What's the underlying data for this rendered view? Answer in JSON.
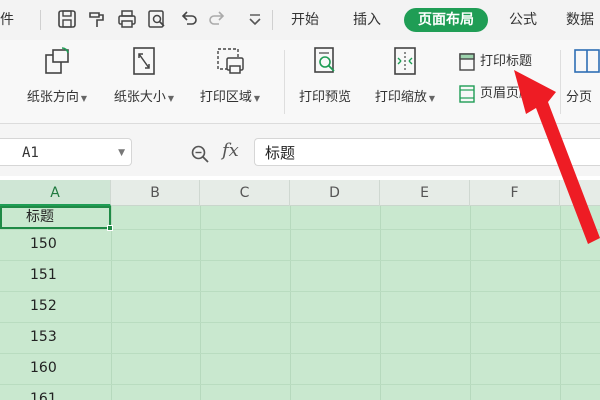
{
  "menu": {
    "file_partial": "件",
    "tabs": [
      {
        "label": "开始"
      },
      {
        "label": "插入"
      },
      {
        "label": "页面布局"
      },
      {
        "label": "公式"
      },
      {
        "label": "数据"
      }
    ]
  },
  "quick_access_icons": [
    "save-icon",
    "format-painter-icon",
    "print-icon",
    "print-preview-icon",
    "undo-icon",
    "redo-icon",
    "customize-chevron-icon"
  ],
  "ribbon": {
    "orientation": "纸张方向",
    "size": "纸张大小",
    "print_area": "打印区域",
    "print_preview": "打印预览",
    "print_scale": "打印缩放",
    "print_titles": "打印标题",
    "header_footer": "页眉页脚",
    "page_break": "分页"
  },
  "formula_bar": {
    "name_box": "A1",
    "fx_label": "fx",
    "content": "标题"
  },
  "columns": [
    "A",
    "B",
    "C",
    "D",
    "E",
    "F"
  ],
  "column_a_values": [
    "标题",
    "150",
    "151",
    "152",
    "153",
    "160",
    "161"
  ],
  "colors": {
    "accent": "#1f9d55",
    "grid_fill": "#c9e8cf",
    "arrow": "#ee1c24"
  }
}
